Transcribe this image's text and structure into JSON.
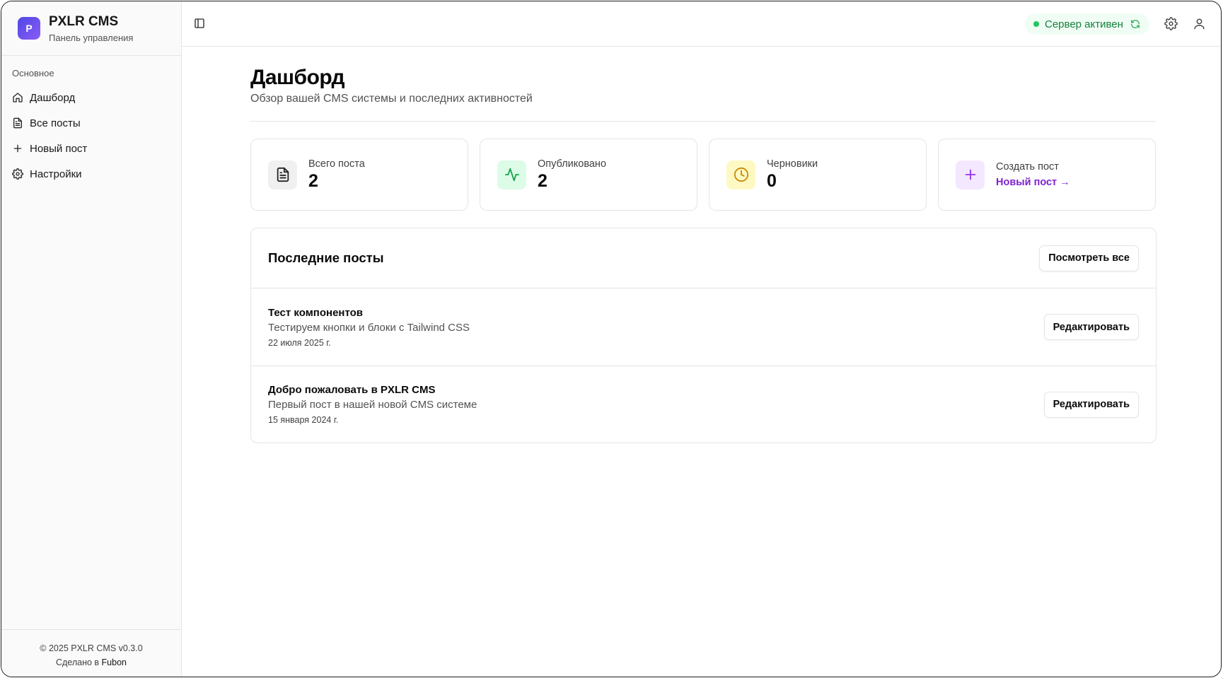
{
  "app": {
    "name": "PXLR CMS",
    "subtitle": "Панель управления",
    "logo_letter": "P"
  },
  "sidebar": {
    "group_label": "Основное",
    "items": [
      {
        "label": "Дашборд",
        "icon": "home-icon"
      },
      {
        "label": "Все посты",
        "icon": "document-icon"
      },
      {
        "label": "Новый пост",
        "icon": "plus-icon"
      },
      {
        "label": "Настройки",
        "icon": "gear-icon"
      }
    ],
    "footer": {
      "copyright": "© 2025 PXLR CMS v0.3.0",
      "made_in": "Сделано в",
      "made_in_link": "Fubon"
    }
  },
  "topbar": {
    "status_label": "Сервер активен",
    "status_color": "#22c55e"
  },
  "page": {
    "title": "Дашборд",
    "subtitle": "Обзор вашей CMS системы и последних активностей"
  },
  "stats": [
    {
      "label": "Всего поста",
      "value": "2",
      "icon": "document-icon",
      "bg": "#f0f0f0",
      "color": "#262626"
    },
    {
      "label": "Опубликовано",
      "value": "2",
      "icon": "activity-icon",
      "bg": "#dcfce7",
      "color": "#16a34a"
    },
    {
      "label": "Черновики",
      "value": "0",
      "icon": "clock-icon",
      "bg": "#fef9c3",
      "color": "#ca8a04"
    },
    {
      "label": "Создать пост",
      "link": "Новый пост →",
      "icon": "plus-icon",
      "bg": "#f3e8ff",
      "color": "#9333ea"
    }
  ],
  "recent_posts": {
    "title": "Последние посты",
    "view_all_label": "Посмотреть все",
    "edit_label": "Редактировать",
    "items": [
      {
        "title": "Тест компонентов",
        "description": "Тестируем кнопки и блоки с Tailwind CSS",
        "date": "22 июля 2025 г."
      },
      {
        "title": "Добро пожаловать в PXLR CMS",
        "description": "Первый пост в нашей новой CMS системе",
        "date": "15 января 2024 г."
      }
    ]
  }
}
